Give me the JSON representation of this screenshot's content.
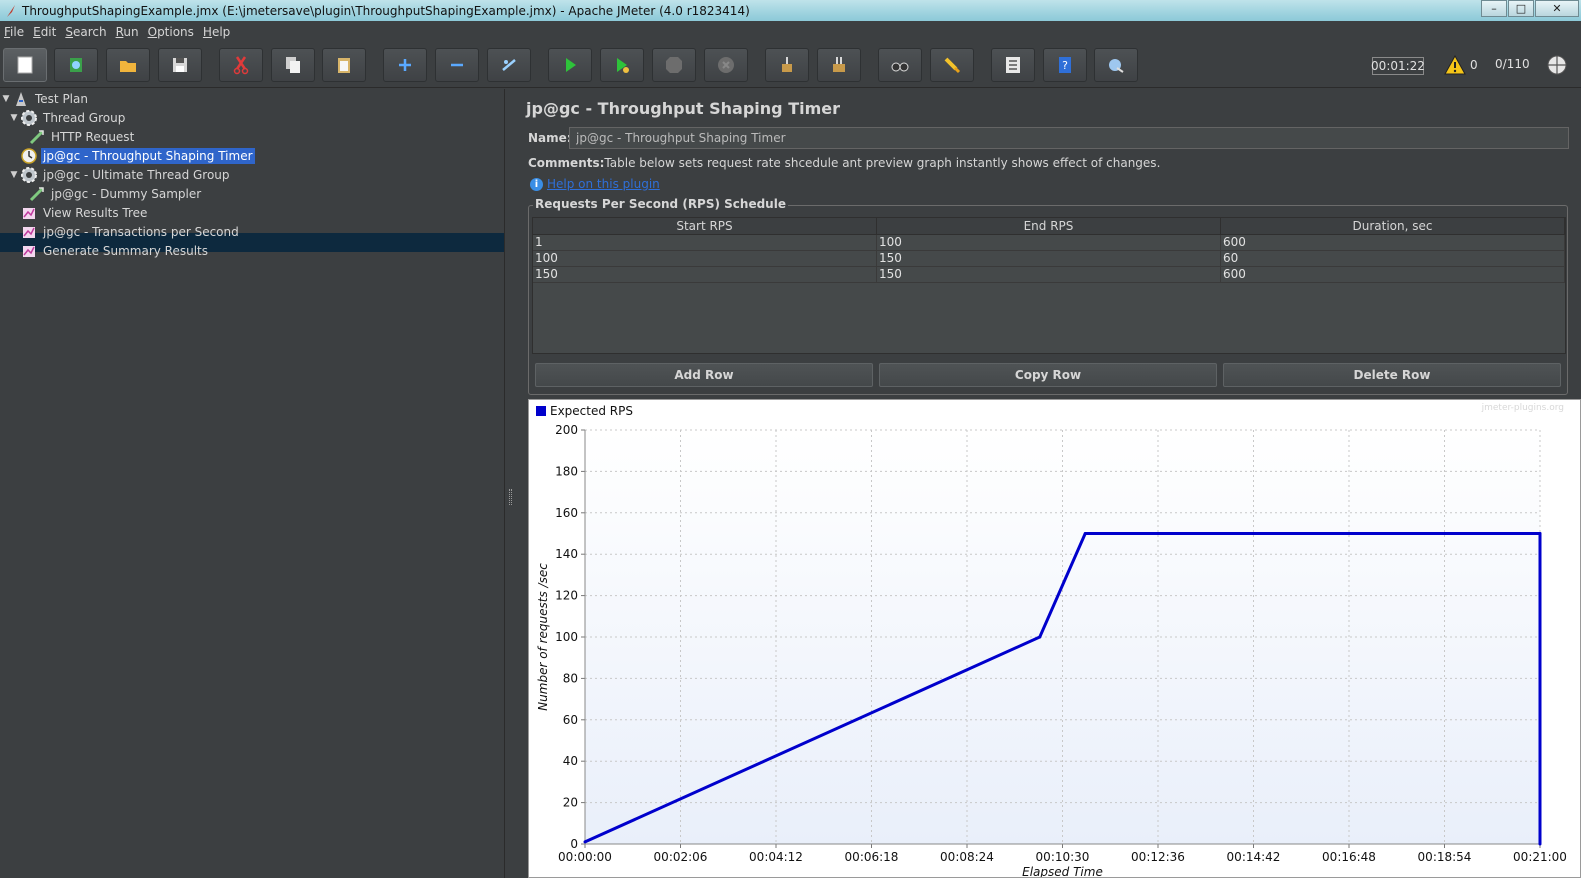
{
  "window": {
    "title": "ThroughputShapingExample.jmx (E:\\jmetersave\\plugin\\ThroughputShapingExample.jmx) - Apache JMeter (4.0 r1823414)"
  },
  "menu": [
    {
      "label": "File",
      "underline": "F",
      "rest": "ile"
    },
    {
      "label": "Edit",
      "underline": "E",
      "rest": "dit"
    },
    {
      "label": "Search",
      "underline": "S",
      "rest": "earch"
    },
    {
      "label": "Run",
      "underline": "R",
      "rest": "un"
    },
    {
      "label": "Options",
      "underline": "O",
      "rest": "ptions"
    },
    {
      "label": "Help",
      "underline": "H",
      "rest": "elp"
    }
  ],
  "toolbar": {
    "elapsed": "00:01:22",
    "warnings": "0",
    "threads": "0/110"
  },
  "tree": [
    {
      "label": "Test Plan",
      "icon": "test-plan-icon",
      "expanded": true
    },
    {
      "label": "Thread Group",
      "icon": "gear-icon",
      "expanded": true
    },
    {
      "label": "HTTP Request",
      "icon": "sampler-icon"
    },
    {
      "label": "jp@gc - Throughput Shaping Timer",
      "icon": "timer-icon",
      "selected": true
    },
    {
      "label": "jp@gc - Ultimate Thread Group",
      "icon": "gear-icon",
      "expanded": true
    },
    {
      "label": "jp@gc - Dummy Sampler",
      "icon": "sampler-icon"
    },
    {
      "label": "View Results Tree",
      "icon": "listener-icon"
    },
    {
      "label": "jp@gc - Transactions per Second",
      "icon": "listener-icon"
    },
    {
      "label": "Generate Summary Results",
      "icon": "listener-icon"
    }
  ],
  "panel": {
    "title": "jp@gc - Throughput Shaping Timer",
    "name_label": "Name:",
    "name_value": "jp@gc - Throughput Shaping Timer",
    "comments_label": "Comments:",
    "comments_text": "Table below sets request rate shcedule ant preview graph instantly shows effect of changes.",
    "help_link": "Help on this plugin",
    "schedule_legend": "Requests Per Second (RPS) Schedule",
    "columns": [
      "Start RPS",
      "End RPS",
      "Duration, sec"
    ],
    "rows": [
      [
        "1",
        "100",
        "600"
      ],
      [
        "100",
        "150",
        "60"
      ],
      [
        "150",
        "150",
        "600"
      ]
    ],
    "buttons": {
      "add": "Add Row",
      "copy": "Copy Row",
      "delete": "Delete Row"
    }
  },
  "chart_data": {
    "type": "line",
    "legend_position": "top-left",
    "watermark": "jmeter-plugins.org",
    "ylabel": "Number of requests /sec",
    "xlabel": "Elapsed Time",
    "ylim": [
      0,
      200
    ],
    "y_ticks": [
      0,
      20,
      40,
      60,
      80,
      100,
      120,
      140,
      160,
      180,
      200
    ],
    "x_tick_labels": [
      "00:00:00",
      "00:02:06",
      "00:04:12",
      "00:06:18",
      "00:08:24",
      "00:10:30",
      "00:12:36",
      "00:14:42",
      "00:16:48",
      "00:18:54",
      "00:21:00"
    ],
    "x_tick_seconds": [
      0,
      126,
      252,
      378,
      504,
      630,
      756,
      882,
      1008,
      1134,
      1260
    ],
    "xlim_seconds": [
      0,
      1260
    ],
    "grid": true,
    "series": [
      {
        "name": "Expected RPS",
        "color": "#0000cc",
        "x_seconds": [
          0,
          600,
          660,
          1260,
          1260
        ],
        "y": [
          1,
          100,
          150,
          150,
          0
        ]
      }
    ]
  }
}
